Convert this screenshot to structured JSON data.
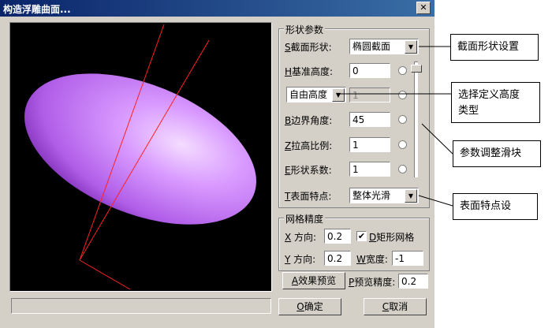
{
  "window": {
    "title": "构造浮雕曲面...",
    "close_symbol": "✕"
  },
  "shape_params": {
    "group_title": "形状参数",
    "section_shape": {
      "hotkey": "S",
      "label": "截面形状:",
      "value": "椭圆截面"
    },
    "base_height": {
      "hotkey": "H",
      "label": "基准高度:",
      "value": "0"
    },
    "height_type": {
      "value": "自由高度",
      "field_value": "1"
    },
    "boundary_angle": {
      "hotkey": "B",
      "label": "边界角度:",
      "value": "45"
    },
    "stretch_ratio": {
      "hotkey": "Z",
      "label": "拉高比例:",
      "value": "1"
    },
    "shape_coef": {
      "hotkey": "E",
      "label": "形状系数:",
      "value": "1"
    },
    "surface_feature": {
      "hotkey": "T",
      "label": "表面特点:",
      "value": "整体光滑"
    }
  },
  "mesh": {
    "group_title": "网格精度",
    "x_dir": {
      "hotkey": "X",
      "label": " 方向:",
      "value": "0.2"
    },
    "rect_mesh": {
      "hotkey": "D",
      "label": "矩形网格",
      "checked": "✔"
    },
    "y_dir": {
      "hotkey": "Y",
      "label": " 方向:",
      "value": "0.2"
    },
    "width": {
      "hotkey": "W",
      "label": "宽度:",
      "value": "-1"
    }
  },
  "preview": {
    "button_hotkey": "A",
    "button_label": "效果预览",
    "precision_hotkey": "P",
    "precision_label": "预览精度:",
    "precision_value": "0.2"
  },
  "buttons": {
    "ok_hotkey": "O",
    "ok_label": "确定",
    "cancel_hotkey": "C",
    "cancel_label": "取消"
  },
  "callouts": {
    "section_shape": "截面形状设置",
    "height_type_line1": "选择定义高度",
    "height_type_line2": "类型",
    "slider": "参数调整滑块",
    "surface": "表面特点设"
  },
  "colors": {
    "ellipsoid": "#c77cf5",
    "axis": "#ff2020",
    "title_bar": "#0a246a",
    "dialog_bg": "#d4d0c8"
  }
}
